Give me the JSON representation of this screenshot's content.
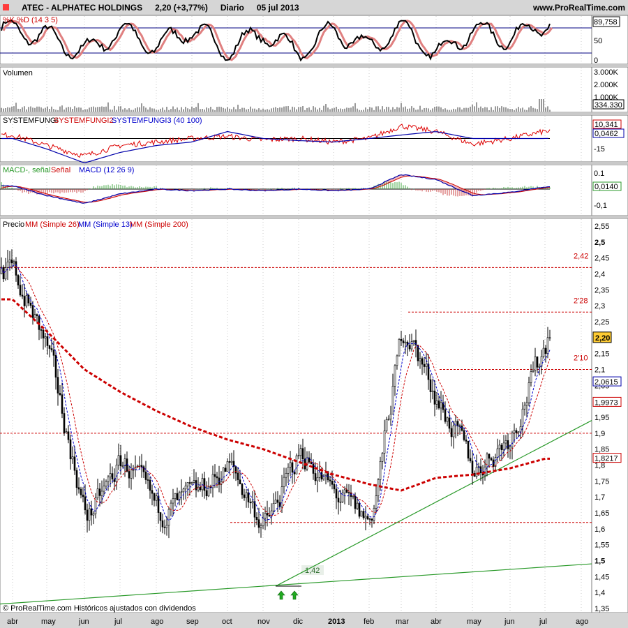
{
  "header": {
    "ticker": "ATEC - ALPHATEC HOLDINGS",
    "price_change": "2,20 (+3,77%)",
    "period": "Diario",
    "date": "05 jul 2013",
    "site": "www.ProRealTime.com"
  },
  "footer": {
    "credit": "© ProRealTime.com  Históricos ajustados con dividendos"
  },
  "colors": {
    "price_line": "#000000",
    "mm26": "#cc0000",
    "mm13": "#0000cc",
    "mm200": "#cc0000",
    "support": "#2a9a2a",
    "resistance": "#cc0000",
    "grid": "#aaaaaa"
  },
  "chart_data": [
    {
      "type": "line",
      "panel": "stochastic",
      "title": "%K %D (14 3 5)",
      "y_ticks": [
        "89,758",
        "50",
        "0"
      ],
      "last_value": "89,758",
      "levels": [
        80,
        20
      ],
      "x": [
        "abr",
        "may",
        "jun",
        "jul",
        "ago",
        "sep",
        "oct",
        "nov",
        "dic",
        "2013",
        "feb",
        "mar",
        "abr",
        "may",
        "jun",
        "jul"
      ],
      "series": [
        {
          "name": "%K",
          "values": [
            75,
            60,
            20,
            75,
            35,
            80,
            25,
            70,
            20,
            75,
            30,
            85,
            15,
            75,
            55,
            89.8
          ]
        }
      ]
    },
    {
      "type": "bar",
      "panel": "volume",
      "title": "Volumen",
      "y_ticks": [
        "3.000K",
        "2.000K",
        "1.000K"
      ],
      "last_value": "334.330"
    },
    {
      "type": "line",
      "panel": "systemfungi",
      "legend": [
        "SYSTEMFUNGI",
        "SYSTEMFUNGI2",
        "SYSTEMFUNGI3 (40 100)"
      ],
      "y_ticks": [
        "10,341",
        "0,0462",
        "-15"
      ],
      "x": [
        "abr",
        "may",
        "jun",
        "jul",
        "ago",
        "sep",
        "oct",
        "nov",
        "dic",
        "2013",
        "feb",
        "mar",
        "abr",
        "may",
        "jun",
        "jul"
      ],
      "series": [
        {
          "name": "SYSTEMFUNGI2",
          "values": [
            5,
            -10,
            -25,
            -10,
            -5,
            0,
            3,
            -2,
            0,
            -5,
            0,
            18,
            10,
            -8,
            0,
            10.3
          ]
        },
        {
          "name": "SYSTEMFUNGI3",
          "values": [
            0,
            -15,
            -35,
            -20,
            -10,
            -5,
            10,
            0,
            -3,
            -5,
            0,
            5,
            10,
            0,
            0,
            0.05
          ]
        }
      ]
    },
    {
      "type": "line",
      "panel": "macd",
      "legend": [
        "MACD-, señal",
        "Señal",
        "MACD (12 26 9)"
      ],
      "y_ticks": [
        "0.1",
        "0",
        "-0,1"
      ],
      "last_value": "0,0140",
      "x": [
        "abr",
        "may",
        "jun",
        "jul",
        "ago",
        "sep",
        "oct",
        "nov",
        "dic",
        "2013",
        "feb",
        "mar",
        "abr",
        "may",
        "jun",
        "jul"
      ],
      "series": [
        {
          "name": "MACD",
          "values": [
            0.02,
            -0.04,
            -0.09,
            -0.03,
            0.0,
            -0.01,
            0.0,
            -0.01,
            0.0,
            -0.01,
            0.0,
            0.09,
            0.06,
            -0.04,
            -0.02,
            0.014
          ]
        }
      ]
    },
    {
      "type": "line",
      "panel": "price",
      "legend": [
        "Precio",
        "MM (Simple 26)",
        "MM (Simple 13)",
        "MM (Simple 200)"
      ],
      "x_ticks": [
        "abr",
        "may",
        "jun",
        "jul",
        "ago",
        "sep",
        "oct",
        "nov",
        "dic",
        "2013",
        "feb",
        "mar",
        "abr",
        "may",
        "jun",
        "jul",
        "ago"
      ],
      "y_ticks": [
        "2,55",
        "2,5",
        "2,45",
        "2,4",
        "2,35",
        "2,3",
        "2,25",
        "2,2",
        "2,15",
        "2,1",
        "2,05",
        "2",
        "1,95",
        "1,9",
        "1,85",
        "1,8",
        "1,75",
        "1,7",
        "1,65",
        "1,6",
        "1,55",
        "1,5",
        "1,45",
        "1,4",
        "1,35"
      ],
      "ylim": [
        1.35,
        2.55
      ],
      "last_price": "2,20",
      "value_tags": [
        "2,0615",
        "1,9973",
        "1,8217"
      ],
      "series": [
        {
          "name": "Precio",
          "x": [
            "abr",
            "may",
            "jun",
            "jul",
            "ago",
            "sep",
            "oct",
            "nov",
            "dic",
            "2013",
            "feb",
            "mar",
            "abr",
            "may",
            "jun",
            "jul"
          ],
          "values": [
            2.4,
            2.15,
            1.62,
            1.82,
            1.65,
            1.7,
            1.8,
            1.6,
            1.85,
            1.7,
            1.62,
            2.25,
            2.0,
            1.78,
            1.9,
            2.2
          ]
        },
        {
          "name": "MM (Simple 200)",
          "x": [
            "abr",
            "may",
            "jun",
            "jul",
            "ago",
            "sep",
            "oct",
            "nov",
            "dic",
            "2013",
            "feb",
            "mar",
            "abr",
            "may",
            "jun",
            "jul"
          ],
          "values": [
            2.32,
            2.22,
            2.1,
            2.03,
            1.97,
            1.92,
            1.88,
            1.85,
            1.81,
            1.77,
            1.74,
            1.72,
            1.76,
            1.77,
            1.79,
            1.82
          ]
        }
      ],
      "annotations": [
        {
          "label": "2,42",
          "value": 2.42
        },
        {
          "label": "2'28",
          "value": 2.28
        },
        {
          "label": "2'10",
          "value": 2.1
        },
        {
          "label": "1,42",
          "value": 1.42
        }
      ],
      "horizontal_levels": [
        2.42,
        2.28,
        2.1,
        1.9,
        1.62
      ]
    }
  ]
}
